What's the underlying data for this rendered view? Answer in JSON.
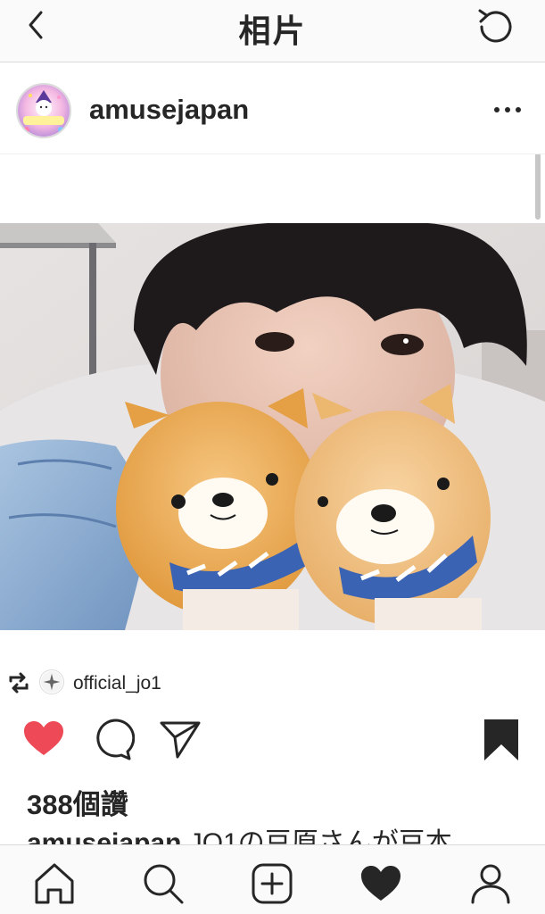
{
  "header": {
    "title": "相片",
    "back_icon": "chevron-left-icon",
    "refresh_icon": "refresh-icon"
  },
  "post": {
    "username": "amusejapan",
    "avatar_text": "AMUFUN",
    "more_icon": "more-dots-icon",
    "photo_description_icon": "post-photo",
    "repost": {
      "icon": "repost-icon",
      "username": "official_jo1"
    },
    "actions": {
      "like_icon": "heart-filled-icon",
      "like_color": "#ed4956",
      "comment_icon": "comment-icon",
      "share_icon": "send-icon",
      "save_icon": "bookmark-filled-icon"
    },
    "likes_text": "388個讚",
    "caption_user": "amusejapan",
    "caption_text": "JO1の豆原さんが豆本"
  },
  "tabbar": {
    "items": [
      {
        "icon": "home-icon"
      },
      {
        "icon": "search-icon"
      },
      {
        "icon": "new-post-icon"
      },
      {
        "icon": "activity-heart-icon"
      },
      {
        "icon": "profile-icon"
      }
    ]
  }
}
